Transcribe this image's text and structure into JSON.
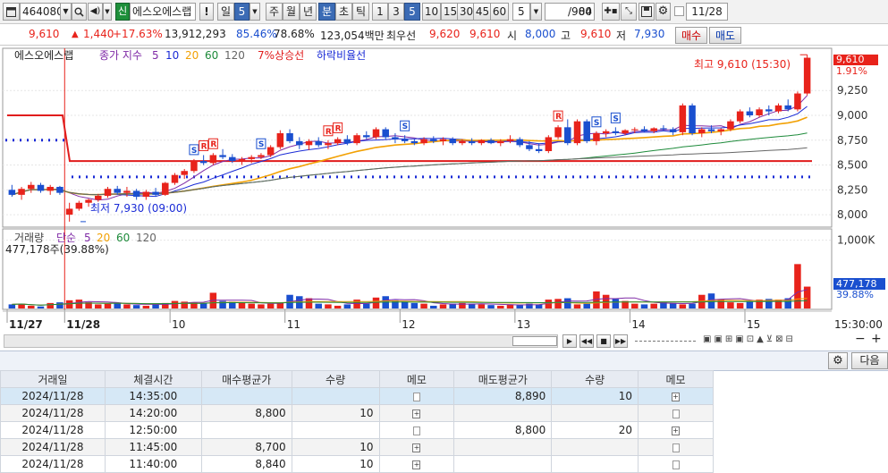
{
  "toolbar": {
    "code": "464080",
    "credit_badge": "신",
    "stock_name": "에스오에스랩",
    "warn": "!",
    "period_day": "일",
    "period_day_value": "5",
    "periods": [
      "주",
      "월",
      "년",
      "분",
      "초",
      "틱"
    ],
    "intervals": [
      "1",
      "3",
      "5",
      "10",
      "15",
      "30",
      "45",
      "60"
    ],
    "interval_select": "5",
    "count": "84",
    "count_total": "/900",
    "date": "11/28"
  },
  "quote": {
    "price": "9,610",
    "change": "1,440",
    "change_pct": "+17.63%",
    "volume": "13,912,293",
    "vol_ratio1": "85.46%",
    "vol_ratio2": "78.68%",
    "amount": "123,054백만",
    "best_ask_label": "최우선",
    "best_ask": "9,620",
    "best_bid": "9,610",
    "open_label": "시",
    "open": "8,000",
    "high_label": "고",
    "high": "9,610",
    "low_label": "저",
    "low": "7,930",
    "buy_button": "매수",
    "sell_button": "매도"
  },
  "chart_legend": {
    "name": "에스오에스랩",
    "ma_title": "종가 지수",
    "ma5": "5",
    "ma10": "10",
    "ma20": "20",
    "ma60": "60",
    "ma120": "120",
    "up_line": "7%상승선",
    "down_line": "하락비율선",
    "high_note": "최고 9,610 (15:30)",
    "low_note": "최저 7,930 (09:00)",
    "current_price_tag": "9,610",
    "current_pct_tag": "1.91%",
    "top_hidden_tag": "9,610"
  },
  "volume_legend": {
    "title": "거래량",
    "simple": "단순",
    "ma5": "5",
    "ma20": "20",
    "ma60": "60",
    "ma120": "120",
    "current": "477,178주(39.88%)",
    "vol_tag": "477,178",
    "vol_pct_tag": "39.88%"
  },
  "axes": {
    "price_ticks": [
      "9,250",
      "9,000",
      "8,750",
      "8,500",
      "8,250",
      "8,000"
    ],
    "volume_ticks": [
      "1,000K"
    ],
    "time_labels": [
      "11/27",
      "11/28",
      "10",
      "11",
      "12",
      "13",
      "14",
      "15",
      "15:30:00"
    ]
  },
  "colors": {
    "up": "#e8231b",
    "down": "#1a4fcf",
    "ma5": "#7f2aa6",
    "ma10": "#1a2bd6",
    "ma20": "#f2a104",
    "ma60": "#1d8a3a",
    "ma120": "#666666",
    "up_line": "#e01c1c",
    "down_line": "#1a2bd6"
  },
  "next_button": "다음",
  "table": {
    "headers": [
      "거래일",
      "체결시간",
      "매수평균가",
      "수량",
      "메모",
      "매도평균가",
      "수량",
      "메모"
    ],
    "rows": [
      [
        "2024/11/28",
        "14:35:00",
        "",
        "",
        "",
        "8,890",
        "10",
        ""
      ],
      [
        "2024/11/28",
        "14:20:00",
        "8,800",
        "10",
        "",
        "",
        "",
        ""
      ],
      [
        "2024/11/28",
        "12:50:00",
        "",
        "",
        "",
        "8,800",
        "20",
        ""
      ],
      [
        "2024/11/28",
        "11:45:00",
        "8,700",
        "10",
        "",
        "",
        "",
        ""
      ],
      [
        "2024/11/28",
        "11:40:00",
        "8,840",
        "10",
        "",
        "",
        "",
        ""
      ]
    ]
  },
  "chart_data": {
    "type": "candlestick",
    "interval": "5분",
    "prices": [
      [
        8250,
        8300,
        8180,
        8200
      ],
      [
        8200,
        8280,
        8150,
        8260
      ],
      [
        8260,
        8330,
        8220,
        8300
      ],
      [
        8300,
        8320,
        8220,
        8240
      ],
      [
        8240,
        8300,
        8200,
        8280
      ],
      [
        8280,
        8290,
        8200,
        8220
      ],
      [
        8000,
        8120,
        7930,
        8060
      ],
      [
        8060,
        8140,
        8040,
        8120
      ],
      [
        8120,
        8160,
        8080,
        8150
      ],
      [
        8150,
        8210,
        8130,
        8190
      ],
      [
        8190,
        8280,
        8170,
        8260
      ],
      [
        8260,
        8290,
        8200,
        8220
      ],
      [
        8220,
        8280,
        8180,
        8240
      ],
      [
        8240,
        8260,
        8150,
        8180
      ],
      [
        8180,
        8250,
        8150,
        8230
      ],
      [
        8230,
        8270,
        8180,
        8200
      ],
      [
        8200,
        8330,
        8190,
        8320
      ],
      [
        8320,
        8420,
        8300,
        8400
      ],
      [
        8400,
        8460,
        8360,
        8440
      ],
      [
        8440,
        8560,
        8420,
        8540
      ],
      [
        8540,
        8600,
        8500,
        8520
      ],
      [
        8520,
        8620,
        8500,
        8600
      ],
      [
        8600,
        8660,
        8560,
        8580
      ],
      [
        8580,
        8610,
        8520,
        8540
      ],
      [
        8540,
        8580,
        8500,
        8560
      ],
      [
        8560,
        8600,
        8520,
        8580
      ],
      [
        8580,
        8620,
        8560,
        8600
      ],
      [
        8600,
        8700,
        8580,
        8680
      ],
      [
        8680,
        8850,
        8660,
        8820
      ],
      [
        8820,
        8860,
        8720,
        8740
      ],
      [
        8740,
        8780,
        8660,
        8700
      ],
      [
        8700,
        8760,
        8650,
        8740
      ],
      [
        8740,
        8780,
        8680,
        8700
      ],
      [
        8700,
        8750,
        8660,
        8720
      ],
      [
        8720,
        8780,
        8700,
        8760
      ],
      [
        8760,
        8800,
        8700,
        8720
      ],
      [
        8720,
        8820,
        8700,
        8800
      ],
      [
        8800,
        8840,
        8760,
        8780
      ],
      [
        8780,
        8880,
        8760,
        8860
      ],
      [
        8860,
        8880,
        8760,
        8780
      ],
      [
        8780,
        8820,
        8720,
        8760
      ],
      [
        8760,
        8800,
        8720,
        8740
      ],
      [
        8740,
        8760,
        8700,
        8720
      ],
      [
        8720,
        8780,
        8700,
        8760
      ],
      [
        8760,
        8790,
        8720,
        8740
      ],
      [
        8740,
        8780,
        8700,
        8760
      ],
      [
        8760,
        8780,
        8700,
        8720
      ],
      [
        8720,
        8760,
        8700,
        8740
      ],
      [
        8740,
        8770,
        8700,
        8720
      ],
      [
        8720,
        8760,
        8700,
        8750
      ],
      [
        8750,
        8770,
        8710,
        8720
      ],
      [
        8720,
        8760,
        8690,
        8740
      ],
      [
        8740,
        8800,
        8720,
        8760
      ],
      [
        8760,
        8780,
        8680,
        8700
      ],
      [
        8700,
        8740,
        8640,
        8660
      ],
      [
        8660,
        8720,
        8620,
        8640
      ],
      [
        8640,
        8800,
        8620,
        8780
      ],
      [
        8780,
        8900,
        8760,
        8880
      ],
      [
        8880,
        8960,
        8700,
        8720
      ],
      [
        8720,
        8960,
        8700,
        8940
      ],
      [
        8940,
        8960,
        8720,
        8740
      ],
      [
        8740,
        8840,
        8700,
        8820
      ],
      [
        8820,
        8860,
        8780,
        8840
      ],
      [
        8840,
        8880,
        8800,
        8820
      ],
      [
        8820,
        8860,
        8800,
        8850
      ],
      [
        8850,
        8880,
        8820,
        8860
      ],
      [
        8860,
        8890,
        8830,
        8840
      ],
      [
        8840,
        8880,
        8820,
        8870
      ],
      [
        8870,
        8900,
        8840,
        8860
      ],
      [
        8860,
        8880,
        8800,
        8830
      ],
      [
        8830,
        9120,
        8800,
        9100
      ],
      [
        9100,
        9120,
        8800,
        8820
      ],
      [
        8820,
        8880,
        8780,
        8860
      ],
      [
        8860,
        8900,
        8820,
        8840
      ],
      [
        8840,
        8870,
        8800,
        8860
      ],
      [
        8860,
        8960,
        8840,
        8940
      ],
      [
        8940,
        9060,
        8920,
        9040
      ],
      [
        9040,
        9080,
        8980,
        9000
      ],
      [
        9000,
        9080,
        8980,
        9060
      ],
      [
        9060,
        9100,
        9000,
        9040
      ],
      [
        9040,
        9120,
        9020,
        9100
      ],
      [
        9100,
        9160,
        9040,
        9060
      ],
      [
        9060,
        9240,
        9040,
        9220
      ],
      [
        9220,
        9610,
        9200,
        9580
      ]
    ],
    "volumes": [
      60,
      70,
      40,
      30,
      80,
      90,
      120,
      130,
      90,
      60,
      70,
      80,
      60,
      50,
      40,
      70,
      80,
      110,
      100,
      90,
      80,
      230,
      110,
      100,
      80,
      70,
      60,
      70,
      90,
      200,
      180,
      150,
      70,
      60,
      40,
      60,
      130,
      70,
      160,
      180,
      120,
      110,
      80,
      70,
      40,
      60,
      70,
      80,
      70,
      60,
      50,
      40,
      60,
      50,
      70,
      60,
      130,
      140,
      150,
      60,
      70,
      250,
      200,
      140,
      110,
      70,
      60,
      70,
      90,
      80,
      60,
      70,
      200,
      220,
      130,
      90,
      80,
      100,
      130,
      140,
      130,
      150,
      650,
      320
    ]
  }
}
